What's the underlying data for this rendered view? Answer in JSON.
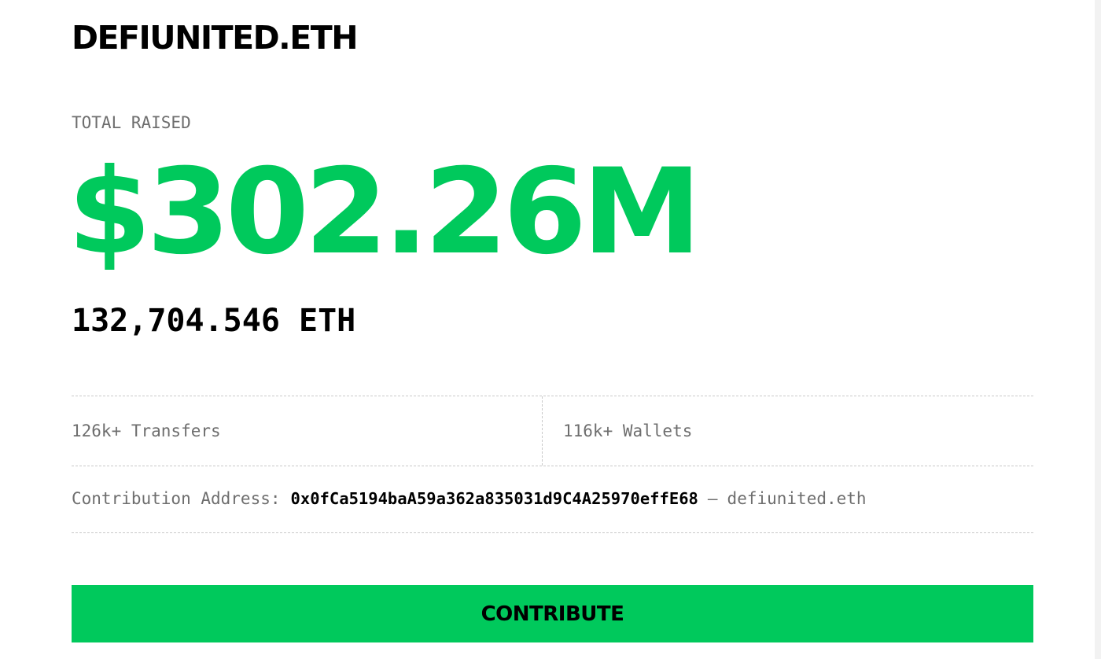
{
  "header": {
    "title": "DEFIUNITED.ETH"
  },
  "raised": {
    "label": "TOTAL RAISED",
    "amount_usd": "$302.26M",
    "amount_eth": "132,704.546 ETH"
  },
  "stats": {
    "transfers": "126k+ Transfers",
    "wallets": "116k+ Wallets"
  },
  "contribution": {
    "label": "Contribution Address:",
    "address": "0x0fCa5194baA59a362a835031d9C4A25970effE68",
    "separator": "—",
    "ens": "defiunited.eth"
  },
  "cta": {
    "label": "CONTRIBUTE"
  },
  "colors": {
    "accent": "#00c95c",
    "text": "#000000",
    "muted": "#6e6e6e",
    "divider": "#c9c9c9"
  }
}
